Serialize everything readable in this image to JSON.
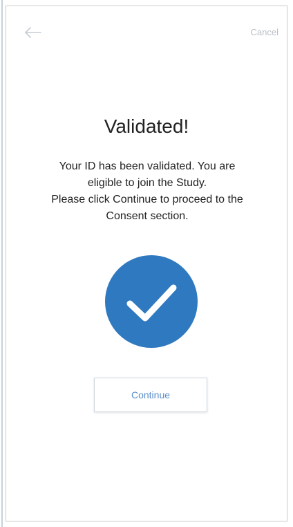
{
  "nav": {
    "back_icon": "arrow-left-icon",
    "cancel_label": "Cancel"
  },
  "main": {
    "title": "Validated!",
    "message_lines": [
      "Your ID has been validated. You are",
      "eligible to join the Study.",
      "Please click Continue to proceed to the",
      "Consent section."
    ],
    "success_icon": "checkmark-icon",
    "continue_label": "Continue"
  },
  "colors": {
    "accent": "#2f79c0",
    "button_text": "#5a8ecb",
    "muted": "#b8bfc6"
  }
}
